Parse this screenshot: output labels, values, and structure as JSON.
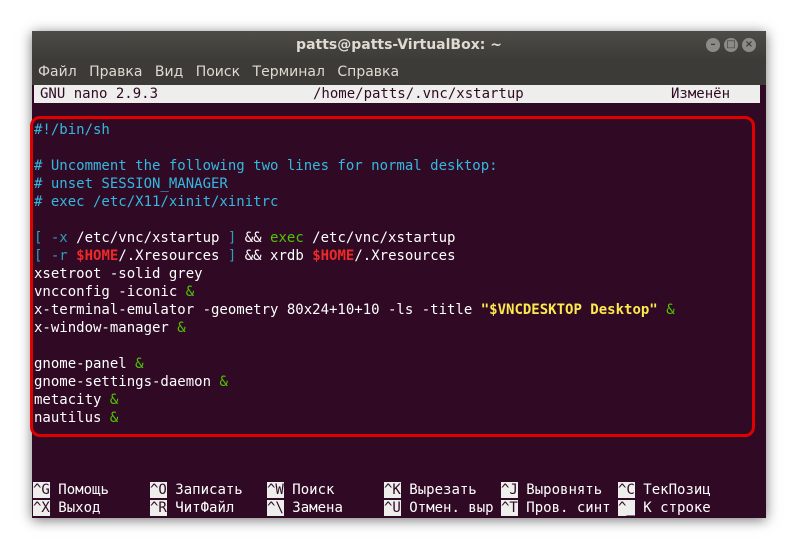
{
  "window": {
    "title": "patts@patts-VirtualBox: ~"
  },
  "menu": [
    "Файл",
    "Правка",
    "Вид",
    "Поиск",
    "Терминал",
    "Справка"
  ],
  "nano": {
    "version": "GNU nano 2.9.3",
    "file": "/home/patts/.vnc/xstartup",
    "status": "Изменён"
  },
  "code": {
    "shebang": "#!/bin/sh",
    "c1": "# Uncomment the following two lines for normal desktop:",
    "c2": "# unset SESSION_MANAGER",
    "c3": "# exec /etc/X11/xinit/xinitrc",
    "l1_b1": "[ -x",
    "l1_mid": " /etc/vnc/xstartup ",
    "l1_b2": "]",
    "l1_amp": " && ",
    "l1_exec": "exec",
    "l1_tail": " /etc/vnc/xstartup",
    "l2_b1": "[ -r",
    "l2_var": "$HOME",
    "l2_mid": "/.Xresources ",
    "l2_b2": "]",
    "l2_amp": " && ",
    "l2_cmd": "xrdb ",
    "l2_var2": "$HOME",
    "l2_tail": "/.Xresources",
    "l3": "xsetroot -solid grey",
    "l4": "vncconfig -iconic ",
    "l5": "x-terminal-emulator -geometry 80x24+10+10 -ls -title ",
    "l5_str": "\"$VNCDESKTOP Desktop\"",
    "l6": "x-window-manager ",
    "l7": "gnome-panel ",
    "l8": "gnome-settings-daemon ",
    "l9": "metacity ",
    "l10": "nautilus ",
    "amp": "&"
  },
  "shortcuts": [
    {
      "key": "^G",
      "label": "Помощь"
    },
    {
      "key": "^O",
      "label": "Записать"
    },
    {
      "key": "^W",
      "label": "Поиск"
    },
    {
      "key": "^K",
      "label": "Вырезать"
    },
    {
      "key": "^J",
      "label": "Выровнять"
    },
    {
      "key": "^C",
      "label": "ТекПозиц"
    },
    {
      "key": "^X",
      "label": "Выход"
    },
    {
      "key": "^R",
      "label": "ЧитФайл"
    },
    {
      "key": "^\\",
      "label": "Замена"
    },
    {
      "key": "^U",
      "label": "Отмен. выр"
    },
    {
      "key": "^T",
      "label": "Пров. синт"
    },
    {
      "key": "^_",
      "label": "К строке"
    }
  ],
  "colors": {
    "terminal_bg": "#300a24",
    "comment": "#34b8e0",
    "keyword": "#4ec600",
    "variable": "#ef2929",
    "string": "#fce94f",
    "highlight": "#e00000"
  }
}
